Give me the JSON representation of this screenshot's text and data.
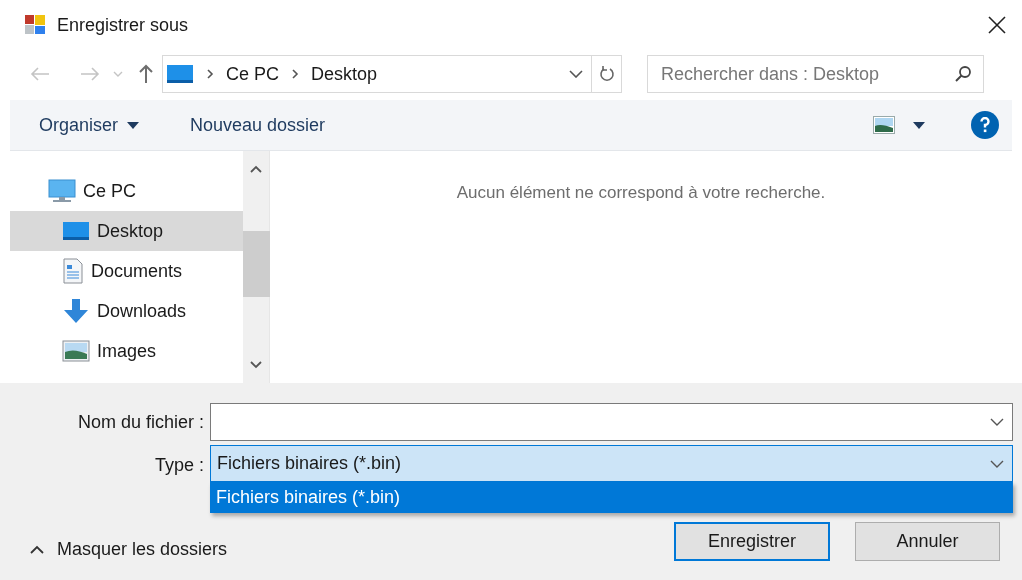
{
  "window": {
    "title": "Enregistrer sous"
  },
  "address_bar": {
    "path": [
      "Ce PC",
      "Desktop"
    ]
  },
  "search": {
    "placeholder": "Rechercher dans : Desktop"
  },
  "toolbar": {
    "organise": "Organiser",
    "new_folder": "Nouveau dossier"
  },
  "sidebar": {
    "items": [
      {
        "label": "Ce PC",
        "selected": false,
        "children": [
          {
            "label": "Desktop",
            "selected": true
          },
          {
            "label": "Documents",
            "selected": false
          },
          {
            "label": "Downloads",
            "selected": false
          },
          {
            "label": "Images",
            "selected": false
          }
        ]
      }
    ]
  },
  "content": {
    "empty_message": "Aucun élément ne correspond à votre recherche."
  },
  "file_name": {
    "label": "Nom du fichier :"
  },
  "file_type": {
    "label": "Type :",
    "value": "Fichiers binaires (*.bin)",
    "expanded": true,
    "options": [
      {
        "label": "Fichiers binaires (*.bin)",
        "selected": true
      }
    ]
  },
  "hide_folders": "Masquer les dossiers",
  "buttons": [
    {
      "label": "Enregistrer",
      "default": true
    },
    {
      "label": "Annuler",
      "default": false
    }
  ]
}
